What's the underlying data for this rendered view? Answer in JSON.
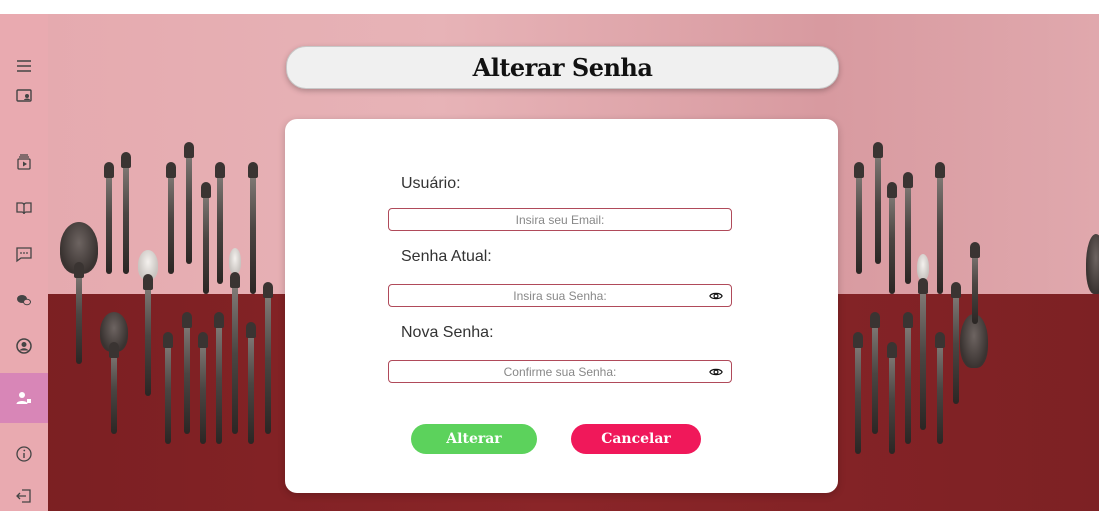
{
  "title": "Alterar Senha",
  "form": {
    "user_label": "Usuário:",
    "email_placeholder": "Insira seu Email:",
    "current_password_label": "Senha Atual:",
    "current_password_placeholder": "Insira sua Senha:",
    "new_password_label": "Nova Senha:",
    "new_password_placeholder": "Confirme sua Senha:",
    "submit_label": "Alterar",
    "cancel_label": "Cancelar"
  },
  "sidebar": {
    "items": [
      {
        "icon": "menu-icon"
      },
      {
        "icon": "profile-card-icon"
      },
      {
        "icon": "video-library-icon"
      },
      {
        "icon": "book-icon"
      },
      {
        "icon": "chat-icon"
      },
      {
        "icon": "conversation-icon"
      },
      {
        "icon": "account-circle-icon"
      },
      {
        "icon": "manage-user-icon",
        "active": true
      },
      {
        "icon": "info-icon"
      },
      {
        "icon": "logout-icon"
      }
    ]
  },
  "colors": {
    "sidebar": "#e9aab0",
    "sidebar_active": "#d886b7",
    "submit": "#5cd25c",
    "cancel": "#f0185a",
    "field_border": "#b04a5a"
  }
}
